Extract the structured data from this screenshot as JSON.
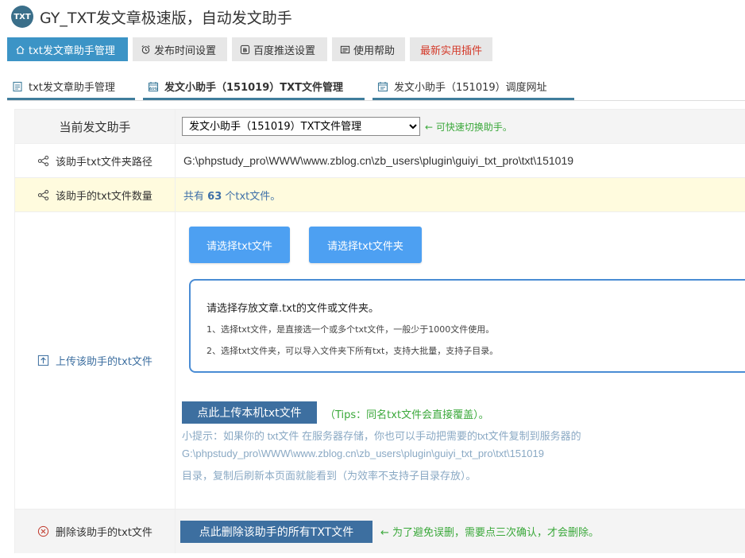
{
  "header": {
    "logo_text": "TXT",
    "title": "GY_TXT发文章极速版，自动发文助手"
  },
  "top_nav": [
    {
      "label": "txt发文章助手管理",
      "icon": "home-icon"
    },
    {
      "label": "发布时间设置",
      "icon": "alarm-clock-icon"
    },
    {
      "label": "百度推送设置",
      "icon": "b-box-icon"
    },
    {
      "label": "使用帮助",
      "icon": "document-icon"
    },
    {
      "label": "最新实用插件",
      "icon": ""
    }
  ],
  "sub_tabs": [
    {
      "label": "txt发文章助手管理",
      "icon": "page-icon"
    },
    {
      "label": "发文小助手（151019）TXT文件管理",
      "icon": "calendar-icon"
    },
    {
      "label": "发文小助手（151019）调度网址",
      "icon": "calendar-icon"
    }
  ],
  "form": {
    "current_helper_label": "当前发文助手",
    "current_helper_value": "发文小助手（151019）TXT文件管理",
    "current_helper_note": "← 可快速切换助手。",
    "folder_path_label": "该助手txt文件夹路径",
    "folder_path_value": "G:\\phpstudy_pro\\WWW\\www.zblog.cn\\zb_users\\plugin\\guiyi_txt_pro\\txt\\151019",
    "file_count_label": "该助手的txt文件数量",
    "file_count_prefix": "共有",
    "file_count_value": "63",
    "file_count_suffix": "个txt文件。",
    "upload_label": "上传该助手的txt文件",
    "select_file_button": "请选择txt文件",
    "select_folder_button": "请选择txt文件夹",
    "info_title": "请选择存放文章.txt的文件或文件夹。",
    "info_line1": "1、选择txt文件，是直接选一个或多个txt文件，一般少于1000文件使用。",
    "info_line2": "2、选择txt文件夹，可以导入文件夹下所有txt，支持大批量，支持子目录。",
    "upload_local_button": "点此上传本机txt文件",
    "upload_tips": "（Tips：同名txt文件会直接覆盖）。",
    "hint_line1": "小提示：如果你的 txt文件 在服务器存储，你也可以手动把需要的txt文件复制到服务器的",
    "hint_line2": "G:\\phpstudy_pro\\WWW\\www.zblog.cn\\zb_users\\plugin\\guiyi_txt_pro\\txt\\151019",
    "hint_line3": "目录，复制后刷新本页面就能看到（为效率不支持子目录存放）。",
    "delete_label": "删除该助手的txt文件",
    "delete_button": "点此删除该助手的所有TXT文件",
    "delete_note": "← 为了避免误删，需要点三次确认，才会删除。"
  },
  "colors": {
    "accent": "#3c94c6",
    "button_blue": "#4da0f2",
    "button_dark": "#3d6fa0",
    "note_green": "#3aa83a",
    "highlight_yellow": "#fffbde"
  }
}
